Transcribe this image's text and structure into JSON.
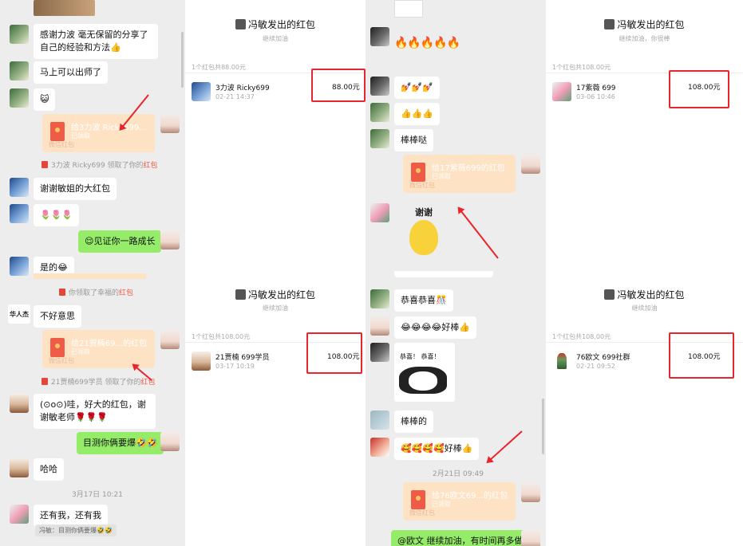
{
  "col1": {
    "msg1": "感谢力波 毫无保留的分享了自己的经验和方法👍",
    "msg2": "马上可以出师了",
    "msg3": "😺",
    "pkt1_title": "给3力波 Ricky699...",
    "pkt1_sub": "已领取",
    "pkt1_foot": "微信红包",
    "sys1_pre": "3力波 Ricky699 领取了你的",
    "sys_hb": "红包",
    "msg4": "谢谢敏姐的大红包",
    "msg5": "🌷🌷🌷",
    "msg6": "😌见证你一路成长",
    "msg7": "是的😂",
    "sys2_pre": "你领取了幸福的",
    "msg8": "不好意思",
    "pkt2_title": "给21贾楠69...的红包",
    "pkt2_sub": "已领取",
    "pkt2_foot": "微信红包",
    "sys3_pre": "21贾楠699学员 领取了你的",
    "msg9": "(⊙o⊙)哇，好大的红包，谢谢敏老师🌹🌹🌹",
    "msg10": "目测你俩要爆🤣🤣",
    "msg11": "哈哈",
    "time1": "3月17日 10:21",
    "msg12": "还有我，还有我",
    "quote": "冯敏：目测你俩要爆🤣🤣",
    "calli_avatar": "华人杰"
  },
  "panel_tl": {
    "title": "冯敏发出的红包",
    "sub": "继续加油",
    "count": "1个红包共88.00元",
    "name": "3力波 Ricky699",
    "time": "02-21 14:37",
    "amount": "88.00元"
  },
  "panel_bl": {
    "title": "冯敏发出的红包",
    "sub": "继续加油",
    "count": "1个红包共108.00元",
    "name": "21贾楠 699学员",
    "time": "03-17 10:19",
    "amount": "108.00元"
  },
  "col3": {
    "emoji1": "🔥🔥🔥🔥🔥",
    "msg1": "💅💅💅",
    "msg2": "👍👍👍",
    "msg3": "棒棒哒",
    "pkt1_title": "给17紫薇699的红包",
    "pkt1_sub": "已领取",
    "pkt1_foot": "微信红包",
    "sticker_text": "谢谢",
    "msg4": "恭喜恭喜🎊",
    "msg5": "😂😂😂😂好棒👍",
    "sticker2_text": "恭喜！ 恭喜！",
    "msg6": "棒棒的",
    "msg7": "🥰🥰🥰🥰好棒👍",
    "time1": "2月21日 09:49",
    "pkt2_title": "给76欧文69...的红包",
    "pkt2_sub": "已领取",
    "pkt2_foot": "微信红包",
    "msg8": "@欧文 继续加油，有时间再多做"
  },
  "panel_tr": {
    "title": "冯敏发出的红包",
    "sub": "继续加油，你很棒",
    "count": "1个红包共108.00元",
    "name": "17紫薇 699",
    "time": "03-06 10:46",
    "amount": "108.00元"
  },
  "panel_br": {
    "title": "冯敏发出的红包",
    "sub": "继续加油",
    "count": "1个红包共108.00元",
    "name": "76欧文 699社群",
    "time": "02-21 09:52",
    "amount": "108.00元"
  },
  "colors": {
    "accent_red": "#e8242c",
    "packet": "#fde2c4",
    "me_bubble": "#95ec69",
    "chat_bg": "#ededed"
  }
}
